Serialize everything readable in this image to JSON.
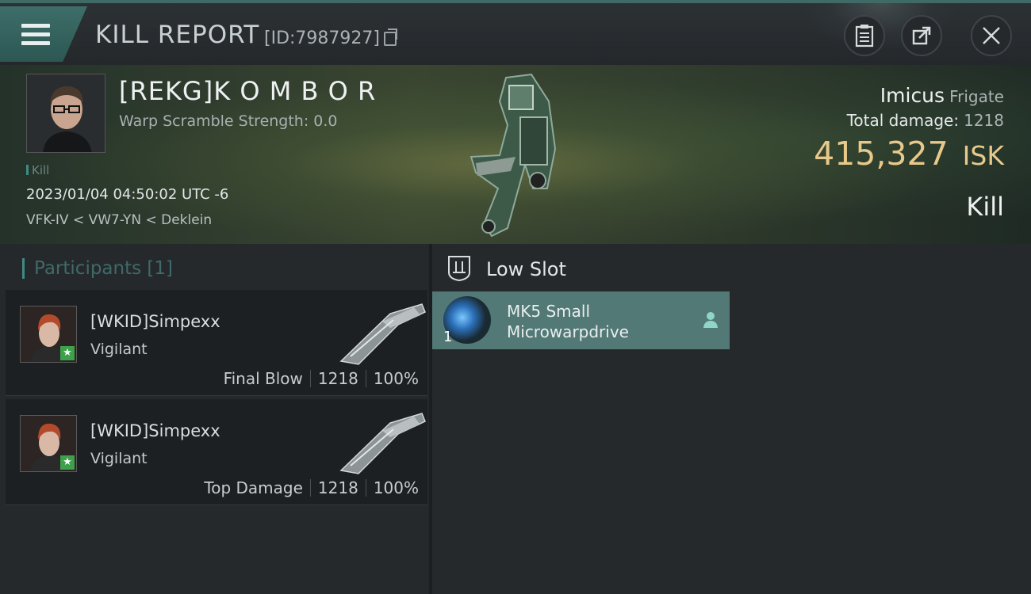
{
  "header": {
    "title": "KILL REPORT",
    "report_id": "[ID:7987927]"
  },
  "victim": {
    "name": "[REKG]K O M B O R",
    "warp_scramble": "Warp Scramble Strength: 0.0",
    "tag": "Kill",
    "datetime": "2023/01/04 04:50:02 UTC -6",
    "location": "VFK-IV < VW7-YN < Deklein",
    "ship_name": "Imicus",
    "ship_class": "Frigate",
    "total_damage_label": "Total damage:",
    "total_damage": "1218",
    "isk_value": "415,327",
    "isk_unit": "ISK",
    "result": "Kill"
  },
  "participants": {
    "title": "Participants [1]",
    "items": [
      {
        "name": "[WKID]Simpexx",
        "ship": "Vigilant",
        "role": "Final Blow",
        "damage": "1218",
        "percent": "100%"
      },
      {
        "name": "[WKID]Simpexx",
        "ship": "Vigilant",
        "role": "Top Damage",
        "damage": "1218",
        "percent": "100%"
      }
    ]
  },
  "fitting": {
    "slot_title": "Low Slot",
    "modules": [
      {
        "qty": "1",
        "name_line1": "MK5 Small",
        "name_line2": "Microwarpdrive"
      }
    ]
  },
  "colors": {
    "accent": "#3f8a85",
    "isk": "#e7c98a",
    "module_bg": "#537977"
  }
}
